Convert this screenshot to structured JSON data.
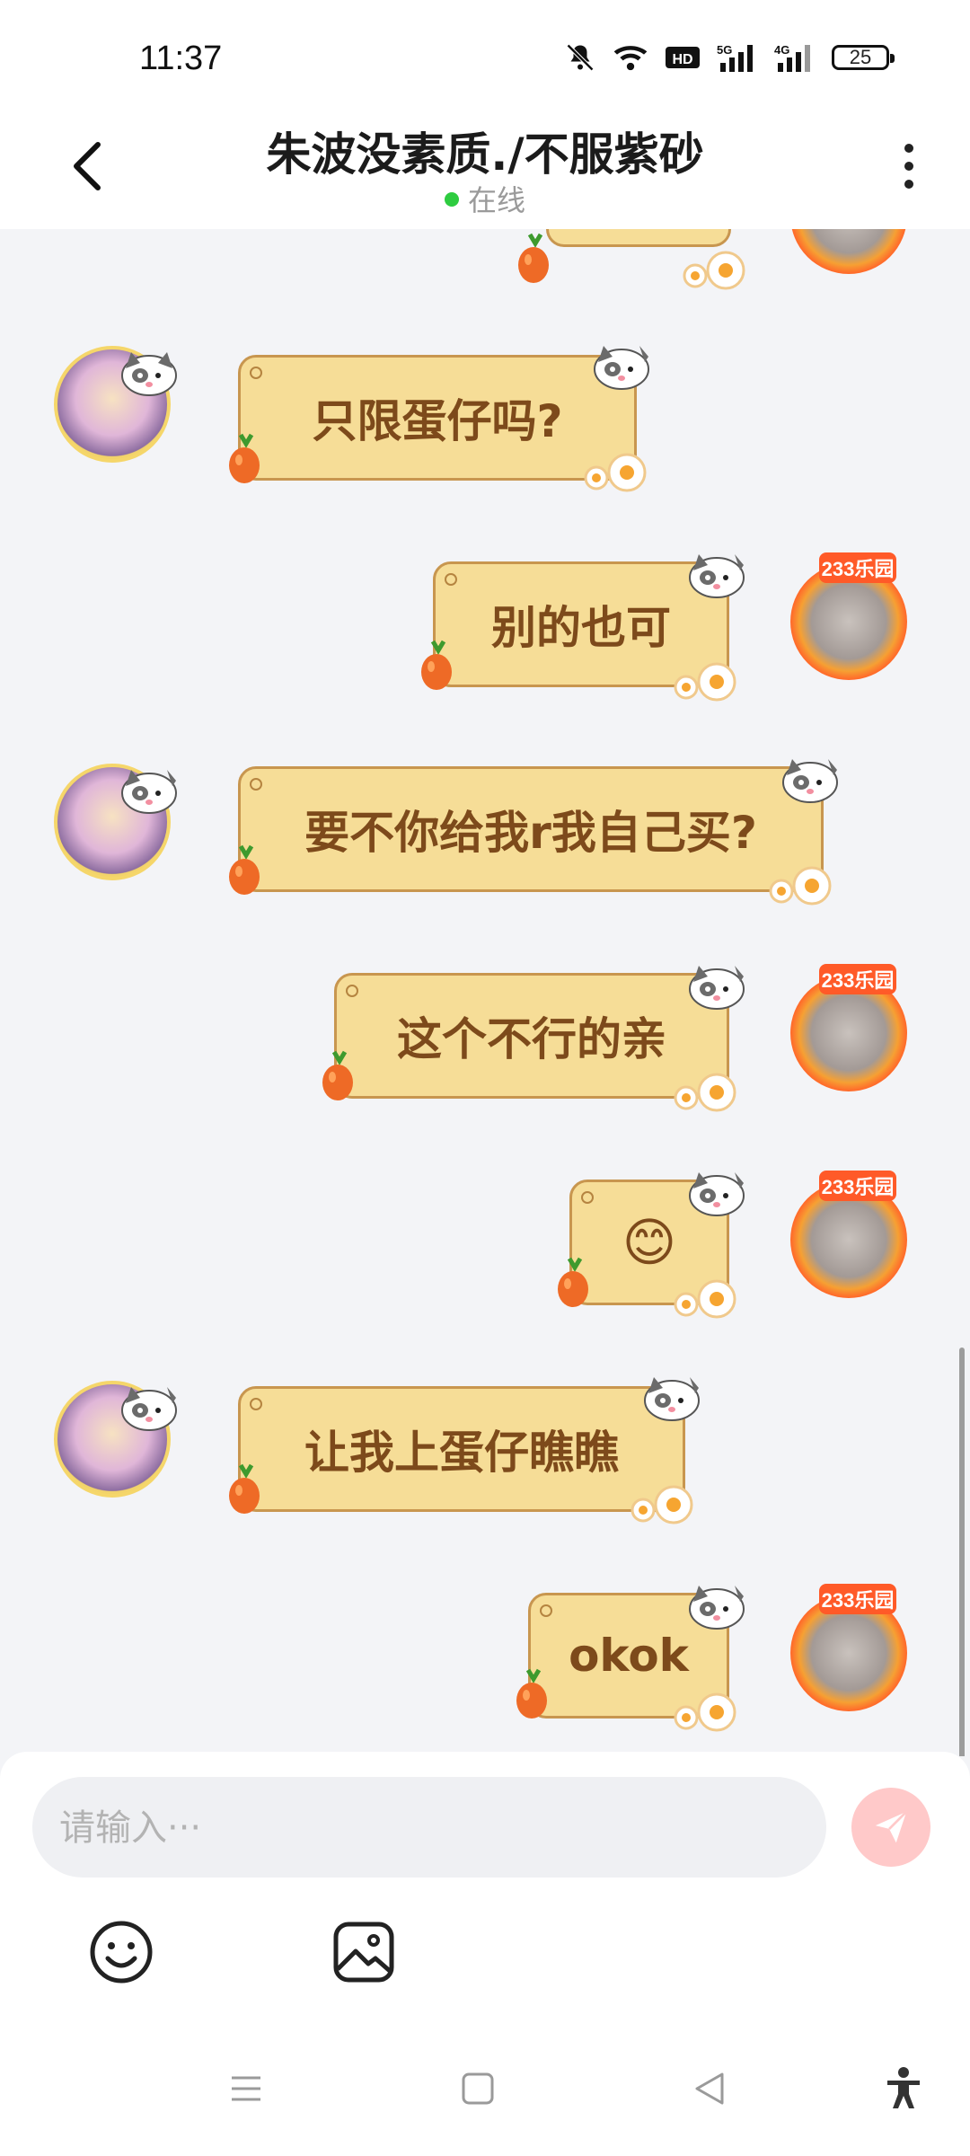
{
  "status_bar": {
    "time": "11:37",
    "battery": "25",
    "network_badges": [
      "HD",
      "5G",
      "4G"
    ]
  },
  "header": {
    "title": "朱波没素质./不服紫砂",
    "status": "在线"
  },
  "messages": [
    {
      "side": "right",
      "text": "…"
    },
    {
      "side": "left",
      "text": "只限蛋仔吗?"
    },
    {
      "side": "right",
      "text": "别的也可"
    },
    {
      "side": "left",
      "text": "要不你给我r我自己买?"
    },
    {
      "side": "right",
      "text": "这个不行的亲"
    },
    {
      "side": "right",
      "text": "😊"
    },
    {
      "side": "left",
      "text": "让我上蛋仔瞧瞧"
    },
    {
      "side": "right",
      "text": "okok"
    }
  ],
  "avatar_badge": "233乐园",
  "input": {
    "placeholder": "请输入···"
  },
  "colors": {
    "bubble_fill": "#f6dd97",
    "bubble_border": "#c8964f",
    "bubble_text": "#7d4a1b",
    "online_dot": "#2ecc40",
    "send_button": "#ffc9c9"
  },
  "icons": {
    "back": "chevron-left-icon",
    "more": "more-vertical-icon",
    "emoji": "smile-icon",
    "image": "image-icon",
    "send": "send-icon",
    "nav_menu": "menu-icon",
    "nav_home": "square-icon",
    "nav_back": "triangle-back-icon",
    "accessibility": "accessibility-icon"
  }
}
